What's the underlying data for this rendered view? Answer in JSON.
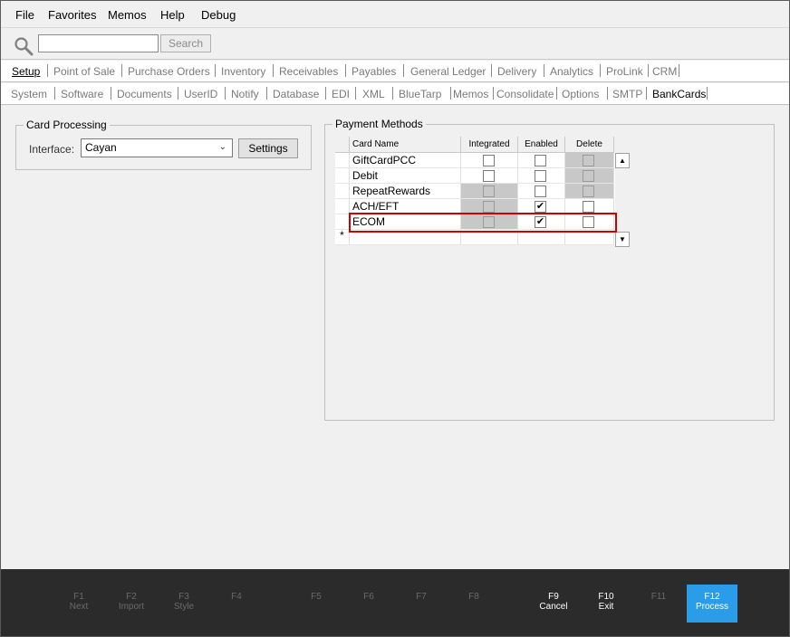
{
  "menu": [
    "File",
    "Favorites",
    "Memos",
    "Help",
    "Debug"
  ],
  "search": {
    "placeholder": "",
    "button": "Search"
  },
  "tabs_row1": [
    "Setup",
    "Point of Sale",
    "Purchase Orders",
    "Inventory",
    "Receivables",
    "Payables",
    "General Ledger",
    "Delivery",
    "Analytics",
    "ProLink",
    "CRM"
  ],
  "tabs_row2": [
    "System",
    "Software",
    "Documents",
    "UserID",
    "Notify",
    "Database",
    "EDI",
    "XML",
    "BlueTarp",
    "Memos",
    "Consolidate",
    "Options",
    "SMTP",
    "BankCards"
  ],
  "card_processing": {
    "title": "Card Processing",
    "interface_label": "Interface:",
    "interface_value": "Cayan",
    "settings_button": "Settings"
  },
  "payment_methods": {
    "title": "Payment Methods",
    "columns": [
      "Card Name",
      "Integrated",
      "Enabled",
      "Delete"
    ],
    "rows": [
      {
        "name": "GiftCardPCC",
        "integrated": false,
        "enabled": false,
        "delete": false
      },
      {
        "name": "Debit",
        "integrated": false,
        "enabled": false,
        "delete": false
      },
      {
        "name": "RepeatRewards",
        "integrated": false,
        "enabled": false,
        "delete": false
      },
      {
        "name": "ACH/EFT",
        "integrated": false,
        "enabled": true,
        "delete": false
      },
      {
        "name": "ECOM",
        "integrated": false,
        "enabled": true,
        "delete": false
      }
    ],
    "new_row_marker": "*"
  },
  "fkeys": [
    {
      "key": "F1",
      "label": "Next"
    },
    {
      "key": "F2",
      "label": "Import"
    },
    {
      "key": "F3",
      "label": "Style"
    },
    {
      "key": "F4",
      "label": ""
    },
    {
      "key": "F5",
      "label": ""
    },
    {
      "key": "F6",
      "label": ""
    },
    {
      "key": "F7",
      "label": ""
    },
    {
      "key": "F8",
      "label": ""
    },
    {
      "key": "F9",
      "label": "Cancel"
    },
    {
      "key": "F10",
      "label": "Exit"
    },
    {
      "key": "F11",
      "label": ""
    },
    {
      "key": "F12",
      "label": "Process"
    }
  ],
  "colors": {
    "highlight": "#d00000",
    "process": "#2b9de8",
    "footer": "#2b2b2b"
  }
}
